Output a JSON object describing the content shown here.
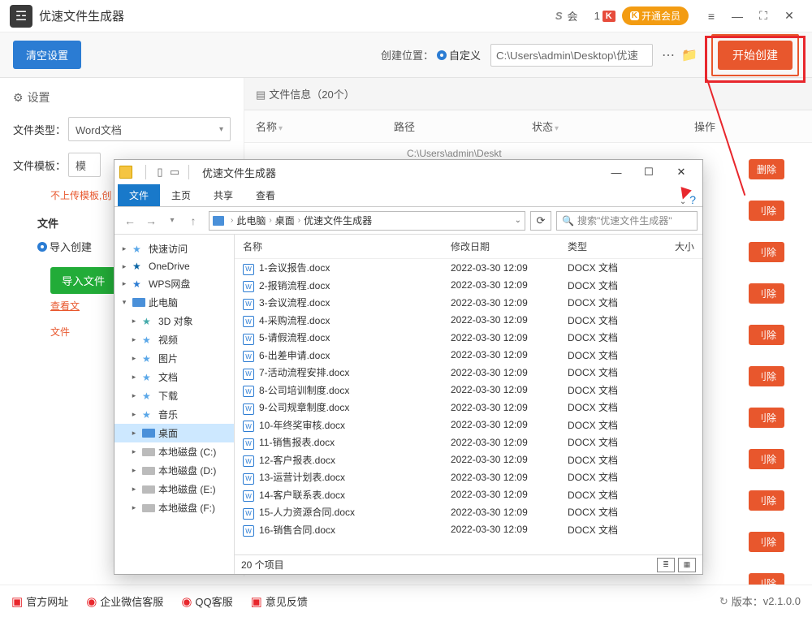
{
  "titlebar": {
    "app_name": "优速文件生成器",
    "s_label": "会",
    "badge_num": "1",
    "badge_letter": "K",
    "vip_icon": "K",
    "vip_label": "开通会员"
  },
  "toolbar": {
    "clear_label": "清空设置",
    "location_label": "创建位置：",
    "custom_label": "自定义",
    "path_value": "C:\\Users\\admin\\Desktop\\优速",
    "start_label": "开始创建"
  },
  "side": {
    "title": "设置",
    "filetype_label": "文件类型：",
    "filetype_value": "Word文档",
    "template_label": "文件模板：",
    "template_value": "模",
    "section_head": "文件",
    "red_note": "不上传模板,创",
    "radio_label": "导入创建",
    "import_btn": "导入文件",
    "view_link": "查看文",
    "link2": "文件"
  },
  "right": {
    "panel_title": "文件信息（20个）",
    "th_name": "名称",
    "th_path": "路径",
    "th_status": "状态",
    "th_op": "操作",
    "sample_path": "C:\\Users\\admin\\Deskt",
    "delete_label": "删除",
    "delete_trunc": "刂除"
  },
  "explorer": {
    "title": "优速文件生成器",
    "tabs": {
      "file": "文件",
      "home": "主页",
      "share": "共享",
      "view": "查看"
    },
    "crumbs": {
      "pc": "此电脑",
      "desktop": "桌面",
      "folder": "优速文件生成器"
    },
    "search_placeholder": "搜索\"优速文件生成器\"",
    "cols": {
      "name": "名称",
      "date": "修改日期",
      "type": "类型",
      "size": "大小"
    },
    "tree": [
      {
        "tw": "▸",
        "cls": "ic-star",
        "label": "快速访问"
      },
      {
        "tw": "▸",
        "cls": "ic-cloud",
        "label": "OneDrive"
      },
      {
        "tw": "▸",
        "cls": "ic-wps",
        "label": "WPS网盘"
      },
      {
        "tw": "▾",
        "cls": "ic-pc",
        "label": "此电脑",
        "box": true
      },
      {
        "tw": "▸",
        "cls": "ic-3d",
        "label": "3D 对象",
        "indent": true
      },
      {
        "tw": "▸",
        "cls": "ic-vid",
        "label": "视频",
        "indent": true
      },
      {
        "tw": "▸",
        "cls": "ic-pic",
        "label": "图片",
        "indent": true
      },
      {
        "tw": "▸",
        "cls": "ic-doc",
        "label": "文档",
        "indent": true
      },
      {
        "tw": "▸",
        "cls": "ic-dl",
        "label": "下载",
        "indent": true
      },
      {
        "tw": "▸",
        "cls": "ic-mus",
        "label": "音乐",
        "indent": true
      },
      {
        "tw": "▸",
        "cls": "ic-desk",
        "label": "桌面",
        "indent": true,
        "box": true,
        "sel": true
      },
      {
        "tw": "▸",
        "cls": "ic-drive",
        "label": "本地磁盘 (C:)",
        "indent": true,
        "box": true
      },
      {
        "tw": "▸",
        "cls": "ic-drive",
        "label": "本地磁盘 (D:)",
        "indent": true,
        "box": true
      },
      {
        "tw": "▸",
        "cls": "ic-drive",
        "label": "本地磁盘 (E:)",
        "indent": true,
        "box": true
      },
      {
        "tw": "▸",
        "cls": "ic-drive",
        "label": "本地磁盘 (F:)",
        "indent": true,
        "box": true
      }
    ],
    "files": [
      {
        "name": "1-会议报告.docx",
        "date": "2022-03-30 12:09",
        "type": "DOCX 文档"
      },
      {
        "name": "2-报销流程.docx",
        "date": "2022-03-30 12:09",
        "type": "DOCX 文档"
      },
      {
        "name": "3-会议流程.docx",
        "date": "2022-03-30 12:09",
        "type": "DOCX 文档"
      },
      {
        "name": "4-采购流程.docx",
        "date": "2022-03-30 12:09",
        "type": "DOCX 文档"
      },
      {
        "name": "5-请假流程.docx",
        "date": "2022-03-30 12:09",
        "type": "DOCX 文档"
      },
      {
        "name": "6-出差申请.docx",
        "date": "2022-03-30 12:09",
        "type": "DOCX 文档"
      },
      {
        "name": "7-活动流程安排.docx",
        "date": "2022-03-30 12:09",
        "type": "DOCX 文档"
      },
      {
        "name": "8-公司培训制度.docx",
        "date": "2022-03-30 12:09",
        "type": "DOCX 文档"
      },
      {
        "name": "9-公司规章制度.docx",
        "date": "2022-03-30 12:09",
        "type": "DOCX 文档"
      },
      {
        "name": "10-年终奖审核.docx",
        "date": "2022-03-30 12:09",
        "type": "DOCX 文档"
      },
      {
        "name": "11-销售报表.docx",
        "date": "2022-03-30 12:09",
        "type": "DOCX 文档"
      },
      {
        "name": "12-客户报表.docx",
        "date": "2022-03-30 12:09",
        "type": "DOCX 文档"
      },
      {
        "name": "13-运营计划表.docx",
        "date": "2022-03-30 12:09",
        "type": "DOCX 文档"
      },
      {
        "name": "14-客户联系表.docx",
        "date": "2022-03-30 12:09",
        "type": "DOCX 文档"
      },
      {
        "name": "15-人力资源合同.docx",
        "date": "2022-03-30 12:09",
        "type": "DOCX 文档"
      },
      {
        "name": "16-销售合同.docx",
        "date": "2022-03-30 12:09",
        "type": "DOCX 文档"
      }
    ],
    "status_count": "20 个项目"
  },
  "footer": {
    "site": "官方网址",
    "wechat": "企业微信客服",
    "qq": "QQ客服",
    "feedback": "意见反馈",
    "version_label": "版本：",
    "version": "v2.1.0.0"
  }
}
